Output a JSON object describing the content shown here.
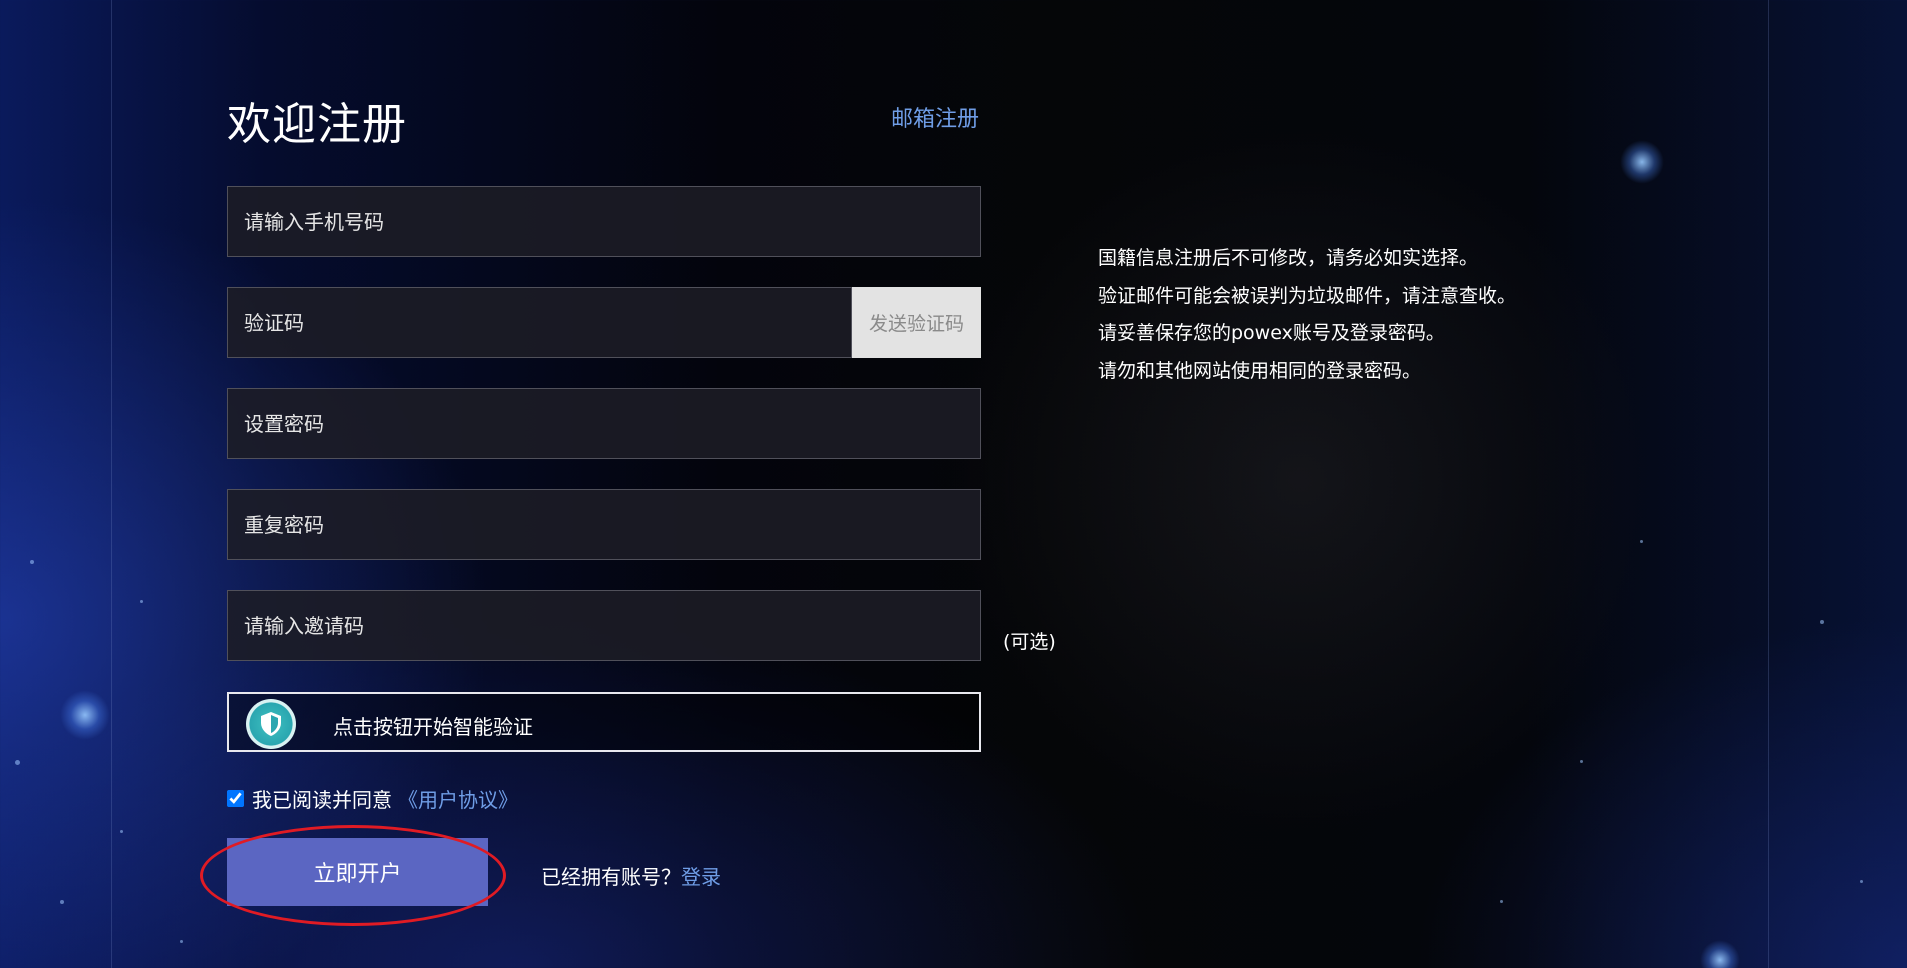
{
  "form": {
    "title": "欢迎注册",
    "email_register_link": "邮箱注册",
    "phone_placeholder": "请输入手机号码",
    "code_placeholder": "验证码",
    "send_code_label": "发送验证码",
    "password_placeholder": "设置密码",
    "repeat_password_placeholder": "重复密码",
    "invite_placeholder": "请输入邀请码",
    "invite_optional_label": "(可选)",
    "captcha_label": "点击按钮开始智能验证",
    "agree_text": "我已阅读并同意",
    "agreement_link": "《用户协议》",
    "agree_checked": true,
    "submit_label": "立即开户",
    "have_account_text": "已经拥有账号？",
    "login_link": "登录"
  },
  "notes": [
    "国籍信息注册后不可修改，请务必如实选择。",
    "验证邮件可能会被误判为垃圾邮件，请注意查收。",
    "请妥善保存您的powex账号及登录密码。",
    "请勿和其他网站使用相同的登录密码。"
  ],
  "colors": {
    "link": "#6f9de6",
    "submit_button": "#5b66c2",
    "highlight_ellipse": "#e01b24",
    "captcha_icon": "#2aa6b0"
  },
  "icons": {
    "captcha": "shield-icon"
  }
}
